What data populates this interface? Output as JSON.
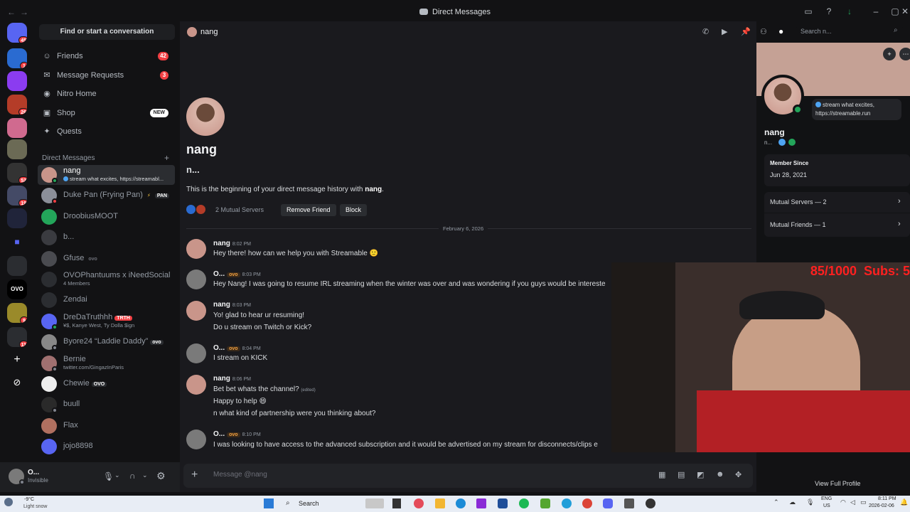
{
  "window": {
    "title": "Direct Messages",
    "back": "←",
    "forward": "→"
  },
  "guilds": {
    "badges": [
      "45",
      "1",
      "26",
      "52",
      "19",
      "9",
      "11"
    ]
  },
  "sidebar": {
    "search": "Find or start a conversation",
    "nav": [
      {
        "label": "Friends",
        "badge": "42"
      },
      {
        "label": "Message Requests",
        "badge": "3"
      },
      {
        "label": "Nitro Home"
      },
      {
        "label": "Shop",
        "badge": "NEW"
      },
      {
        "label": "Quests"
      }
    ],
    "dm_header": "Direct Messages",
    "dm_plus": "+",
    "dms": [
      {
        "name": "nang",
        "sub": "stream what excites, https://streamabl...",
        "color": "#c9958a",
        "status": "#23a55a"
      },
      {
        "name": "Duke Pan (Frying Pan)",
        "tag": "PAN",
        "color": "#8b8f99",
        "status": "#f23f43"
      },
      {
        "name": "DroobiusMOOT",
        "color": "#23a55a",
        "status": ""
      },
      {
        "name": "b...",
        "color": "#3a3b40",
        "status": ""
      },
      {
        "name": "Gfuse",
        "tag": "ovo",
        "color": "#4a4b50",
        "status": ""
      },
      {
        "name": "OVOPhantuums x iNeedSocial",
        "sub": "4 Members",
        "color": "#2b2d31",
        "status": ""
      },
      {
        "name": "Zendai",
        "color": "#2b2d31",
        "status": ""
      },
      {
        "name": "DreDaTruthhh",
        "tag": "TRTH",
        "sub": "¥$, Kanye West, Ty Dolla $ign",
        "color": "#5865f2",
        "status": "#23a55a"
      },
      {
        "name": "Byore24 “Laddie Daddy”",
        "tag": "ovo",
        "color": "#888",
        "status": "#80848e"
      },
      {
        "name": "Bernie",
        "sub": "twitter.com/GingazInParis",
        "color": "#a07070",
        "status": "#80848e"
      },
      {
        "name": "Chewie",
        "tag": "OVO",
        "color": "#eee",
        "status": ""
      },
      {
        "name": "buull",
        "color": "#2a2a2a",
        "status": "#80848e"
      },
      {
        "name": "Flax",
        "color": "#b07060",
        "status": ""
      },
      {
        "name": "jojo8898",
        "color": "#5865f2",
        "status": ""
      }
    ]
  },
  "user": {
    "name": "O...",
    "status": "Invisible"
  },
  "chat": {
    "header_name": "nang",
    "search_placeholder": "Search n...",
    "intro_name": "nang",
    "intro_username": "n...",
    "intro_text": "This is the beginning of your direct message history with",
    "intro_text_name": "nang",
    "mutual_servers": "2 Mutual Servers",
    "remove_friend": "Remove Friend",
    "block": "Block",
    "date_divider": "February 6, 2026",
    "messages": [
      {
        "author": "nang",
        "time": "8:02 PM",
        "lines": [
          "Hey there! how can we help you with Streamable 🙂"
        ]
      },
      {
        "author": "O...",
        "tag": "ovo",
        "time": "8:03 PM",
        "lines": [
          "Hey Nang! I was going to resume IRL streaming when the winter was over and was wondering if you guys would be intereste"
        ]
      },
      {
        "author": "nang",
        "time": "8:03 PM",
        "lines": [
          "Yo! glad to hear ur resuming!",
          "Do u stream on Twitch or Kick?"
        ]
      },
      {
        "author": "O...",
        "tag": "ovo",
        "time": "8:04 PM",
        "lines": [
          "I stream on KICK"
        ]
      },
      {
        "author": "nang",
        "time": "8:06 PM",
        "lines": [
          "Bet bet whats the channel?",
          "Happy to help 😄",
          "n what kind of partnership were you thinking about?"
        ],
        "edited": "(edited)"
      },
      {
        "author": "O...",
        "tag": "ovo",
        "time": "8:10 PM",
        "lines": [
          "I was looking to have access to the advanced subscription and it would be advertised on my stream for disconnects/clips e"
        ]
      }
    ],
    "composer_placeholder": "Message @nang"
  },
  "profile": {
    "name": "nang",
    "username": "n...",
    "custom_status": "stream what excites, https://streamable.run",
    "member_since_label": "Member Since",
    "member_since": "Jun 28, 2021",
    "mutual_servers": "Mutual Servers — 2",
    "mutual_friends": "Mutual Friends — 1",
    "view_full": "View Full Profile"
  },
  "overlay": {
    "counter": "85/1000  Subs: 5"
  },
  "taskbar": {
    "weather_temp": "-9°C",
    "weather_desc": "Light snow",
    "search": "Search",
    "lang": "ENG",
    "region": "US",
    "time": "8:11 PM",
    "date": "2026-02-06"
  },
  "colors": {
    "accent": "#5865f2",
    "red": "#f23f43",
    "green": "#23a55a"
  }
}
